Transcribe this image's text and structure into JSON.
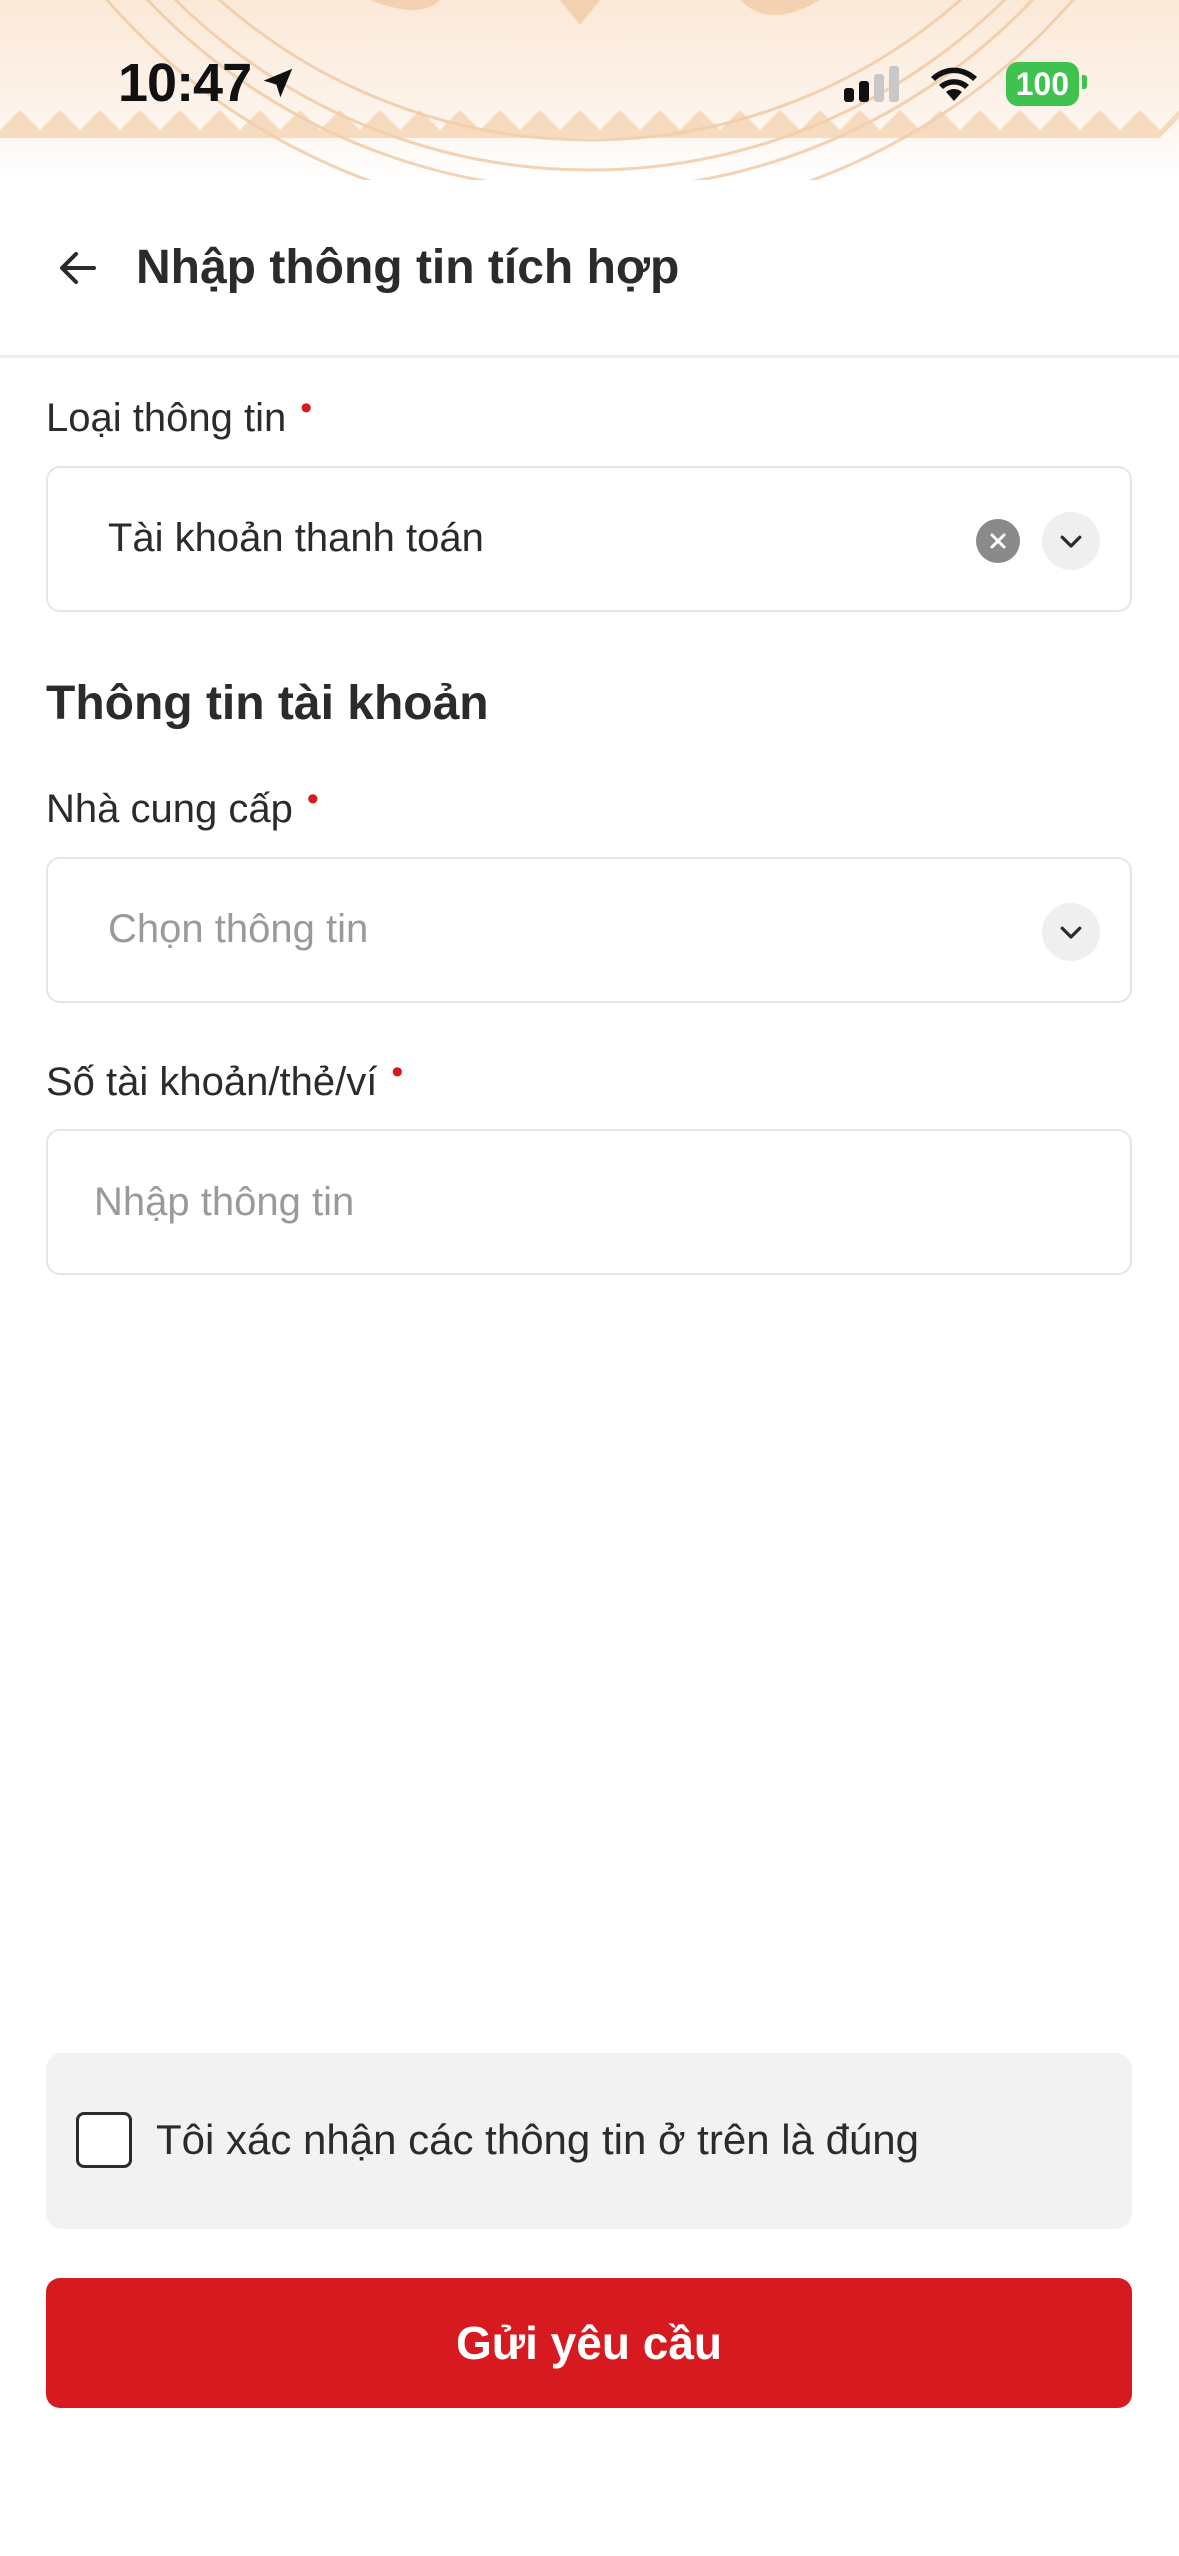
{
  "status_bar": {
    "time": "10:47",
    "battery": "100",
    "colors": {
      "battery": "#3fc24f"
    }
  },
  "header": {
    "title": "Nhập thông tin tích hợp",
    "back_icon": "arrow-left-icon"
  },
  "form": {
    "info_type": {
      "label": "Loại thông tin",
      "required_mark": "•",
      "value": "Tài khoản thanh toán",
      "icons": [
        "clear-icon",
        "chevron-down-icon"
      ]
    },
    "section_title": "Thông tin tài khoản",
    "provider": {
      "label": "Nhà cung cấp",
      "required_mark": "•",
      "placeholder": "Chọn thông tin",
      "icon": "chevron-down-icon"
    },
    "account_number": {
      "label": "Số tài khoản/thẻ/ví",
      "required_mark": "•",
      "placeholder": "Nhập thông tin",
      "value": ""
    }
  },
  "confirm": {
    "checked": false,
    "text": "Tôi xác nhận các thông tin ở trên là đúng"
  },
  "submit": {
    "label": "Gửi yêu cầu"
  },
  "colors": {
    "primary": "#d71920",
    "required": "#d71920",
    "text": "#2b2b2b",
    "placeholder": "#9a9a9a"
  }
}
